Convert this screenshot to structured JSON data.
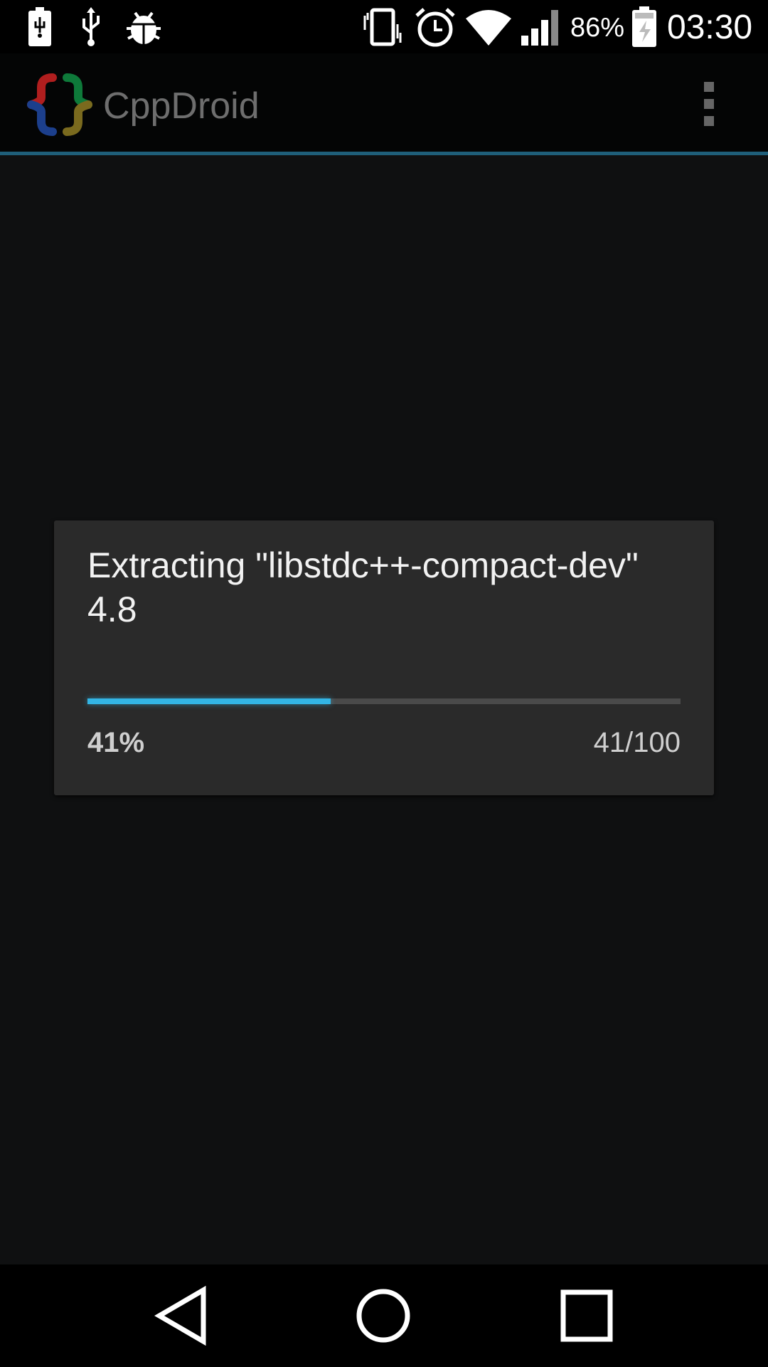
{
  "status_bar": {
    "battery_percent": "86%",
    "time": "03:30",
    "icons": [
      "battery-charging-icon",
      "usb-icon",
      "bug-icon",
      "vibrate-icon",
      "alarm-icon",
      "wifi-icon",
      "signal-icon",
      "battery-icon"
    ]
  },
  "action_bar": {
    "title": "CppDroid",
    "logo_colors": [
      "#b01e1e",
      "#1c3f8c",
      "#0e7a3a",
      "#7a6a1e"
    ],
    "overflow_icon": "overflow-menu-icon",
    "accent_color": "#1f5f7a"
  },
  "dialog": {
    "message": "Extracting \"libstdc++-compact-dev\" 4.8",
    "progress": 0.41,
    "percent_label": "41%",
    "count_label": "41/100",
    "progress_color": "#33b5e5"
  },
  "nav_bar": {
    "buttons": [
      "back-icon",
      "home-icon",
      "recents-icon"
    ]
  }
}
